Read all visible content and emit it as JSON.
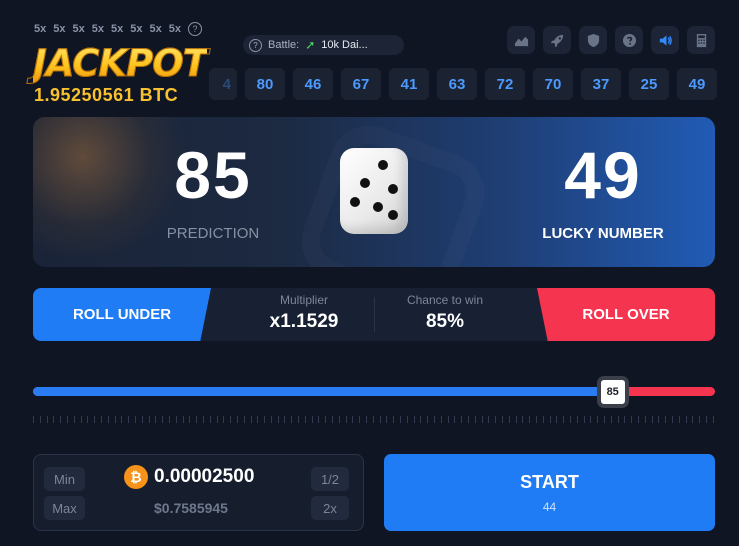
{
  "jackpot": {
    "multipliers": [
      "5x",
      "5x",
      "5x",
      "5x",
      "5x",
      "5x",
      "5x",
      "5x"
    ],
    "title": "JACKPOT",
    "value": "1.95250561 BTC"
  },
  "battle": {
    "label": "Battle:",
    "value": "10k Dai..."
  },
  "toolbar": {
    "icons": [
      "chart-icon",
      "rocket-icon",
      "shield-icon",
      "help-icon",
      "volume-icon",
      "calculator-icon"
    ]
  },
  "history": [
    "4",
    "80",
    "46",
    "67",
    "41",
    "63",
    "72",
    "70",
    "37",
    "25",
    "49"
  ],
  "result": {
    "prediction": "85",
    "prediction_label": "PREDICTION",
    "lucky_number": "49",
    "lucky_label": "LUCKY NUMBER"
  },
  "roll": {
    "under_label": "ROLL UNDER",
    "over_label": "ROLL OVER",
    "multiplier_label": "Multiplier",
    "multiplier_value": "x1.1529",
    "chance_label": "Chance to win",
    "chance_value": "85%"
  },
  "slider": {
    "value": "85",
    "fraction": 0.85,
    "under_color": "#2a7cf3",
    "over_color": "#f5344f"
  },
  "bet": {
    "min_label": "Min",
    "max_label": "Max",
    "half_label": "1/2",
    "double_label": "2x",
    "coin_symbol": "₿",
    "amount": "0.00002500",
    "usd": "$0.7585945"
  },
  "start": {
    "label": "START",
    "sub": "44"
  },
  "colors": {
    "accent_blue": "#1f7cf5",
    "accent_red": "#f5344f",
    "gold": "#f7c12f",
    "background": "#0f1522"
  }
}
